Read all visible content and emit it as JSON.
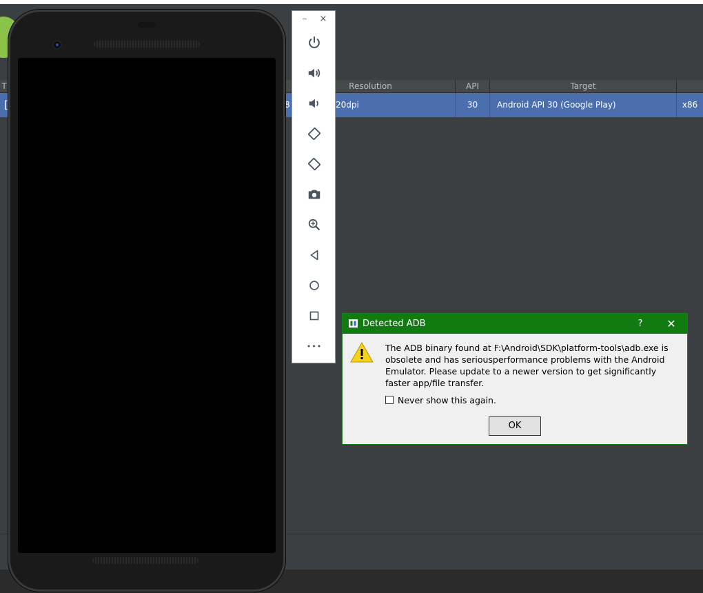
{
  "avd_manager": {
    "columns": [
      "T",
      "Resolution",
      "API",
      "Target"
    ],
    "row": {
      "resolution_fragment": "20dpi",
      "api": "30",
      "target": "Android API 30 (Google Play)",
      "cpu": "x86",
      "type_fragment": "[",
      "partial_fragment": "8"
    }
  },
  "emulator_toolbar": {
    "minimize": "–",
    "close": "×",
    "buttons": [
      "power-icon",
      "volume-up-icon",
      "volume-down-icon",
      "rotate-left-icon",
      "rotate-right-icon",
      "camera-icon",
      "zoom-icon",
      "back-icon",
      "home-icon",
      "overview-icon",
      "more-icon"
    ],
    "more_label": "•••"
  },
  "dialog": {
    "title": "Detected ADB",
    "help": "?",
    "close": "✕",
    "message": "The ADB binary found at F:\\Android\\SDK\\platform-tools\\adb.exe is obsolete and has seriousperformance problems with the Android Emulator. Please update to a newer version to get significantly faster app/file transfer.",
    "checkbox_label": "Never show this again.",
    "ok_label": "OK",
    "title_bar_color": "#117a11"
  }
}
